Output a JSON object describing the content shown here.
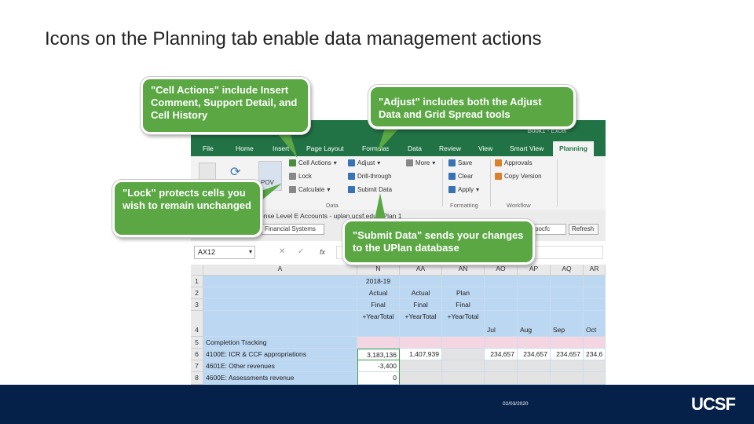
{
  "slide": {
    "title": "Icons on the Planning tab enable data management actions"
  },
  "excel": {
    "window_title": "Book1 - Excel",
    "tabs": [
      {
        "label": "File"
      },
      {
        "label": "Home"
      },
      {
        "label": "Insert"
      },
      {
        "label": "Page Layout"
      },
      {
        "label": "Formulas"
      },
      {
        "label": "Data"
      },
      {
        "label": "Review"
      },
      {
        "label": "View"
      },
      {
        "label": "Smart View"
      },
      {
        "label": "Planning"
      }
    ],
    "ribbon": {
      "pov_label": "POV",
      "cell_actions": "Cell Actions",
      "lock": "Lock",
      "calculate": "Calculate",
      "adjust": "Adjust",
      "drill_through": "Drill-through",
      "submit_data": "Submit Data",
      "more": "More",
      "save": "Save",
      "clear": "Clear",
      "apply": "Apply",
      "approvals": "Approvals",
      "copy_version": "Copy Version",
      "group_data": "Data",
      "group_formatting": "Formatting",
      "group_workflow": "Workflow"
    },
    "pool": {
      "sheet_label": "ense Level E Accounts - uplan.ucsf.edu - Plan 1",
      "dropdown1": "Financial Systems",
      "dropdown2": "pocfc",
      "refresh": "Refresh"
    },
    "formula_bar": {
      "name_box": "AX12",
      "fx": "fx"
    },
    "grid": {
      "columns": [
        "A",
        "N",
        "AA",
        "AN",
        "AO",
        "AP",
        "AQ",
        "AR"
      ],
      "row_numbers": [
        "1",
        "2",
        "3",
        "4",
        "5",
        "6",
        "7",
        "8"
      ],
      "rows": [
        [
          "",
          "2018-19",
          "",
          "",
          "",
          "",
          "",
          ""
        ],
        [
          "",
          "Actual",
          "Actual",
          "Plan",
          "",
          "",
          "",
          ""
        ],
        [
          "",
          "Final",
          "Final",
          "Final",
          "",
          "",
          "",
          ""
        ],
        [
          "",
          "+YearTotal",
          "+YearTotal",
          "+YearTotal",
          "Jul",
          "Aug",
          "Sep",
          "Oct"
        ],
        [
          "Completion Tracking",
          "",
          "",
          "",
          "",
          "",
          "",
          ""
        ],
        [
          "4100E: ICR & CCF appropriations",
          "3,183,136",
          "1,407,939",
          "",
          "234,657",
          "234,657",
          "234,657",
          "234,6"
        ],
        [
          "4601E: Other revenues",
          "-3,400",
          "",
          "",
          "",
          "",
          "",
          ""
        ],
        [
          "4600E: Assessments revenue",
          "0",
          "",
          "",
          "",
          "",
          "",
          ""
        ]
      ]
    }
  },
  "callouts": {
    "cell_actions": "\"Cell Actions\" include Insert Comment, Support Detail, and Cell History",
    "adjust": "\"Adjust\" includes both the Adjust Data and Grid Spread tools",
    "lock": "\"Lock\" protects cells you wish to remain unchanged",
    "submit": "\"Submit Data\" sends your changes to the UPlan database"
  },
  "footer": {
    "date": "02/03/2020",
    "logo": "UCSF"
  }
}
